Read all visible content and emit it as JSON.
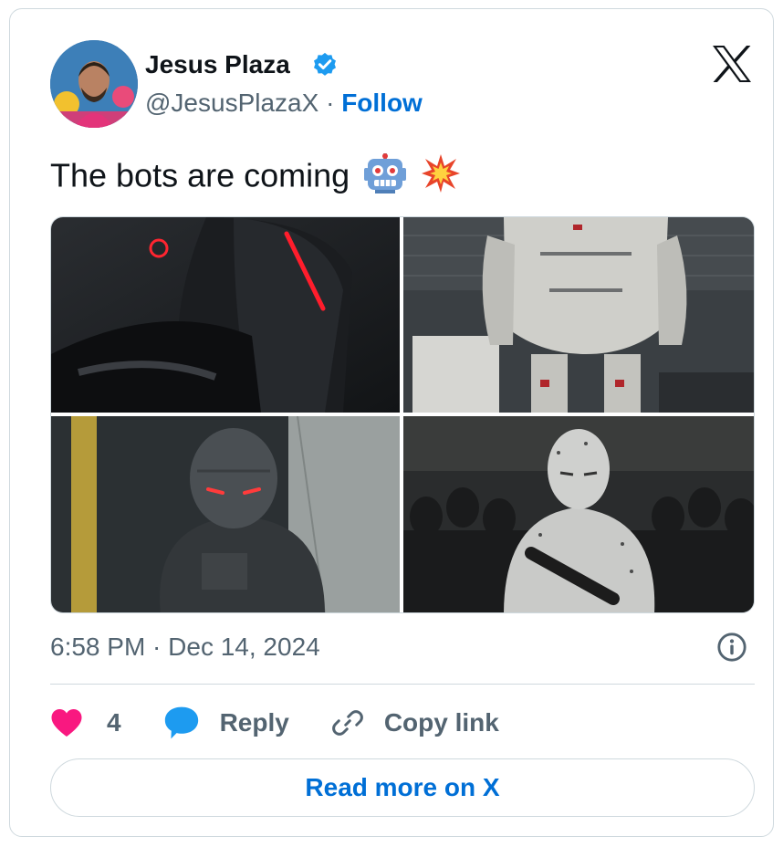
{
  "author": {
    "name": "Jesus Plaza",
    "handle": "@JesusPlazaX",
    "separator": " · ",
    "follow_label": "Follow",
    "verified": true,
    "avatar_icon": "profile-photo"
  },
  "brand": {
    "logo_icon": "x-logo-icon"
  },
  "tweet": {
    "text": "The bots are coming",
    "emojis": [
      "robot-face",
      "collision"
    ],
    "media_count": 4
  },
  "timestamp": "6:58 PM · Dec 14, 2024",
  "actions": {
    "like_count": "4",
    "reply_label": "Reply",
    "copy_label": "Copy link"
  },
  "read_more_label": "Read more on X",
  "colors": {
    "link": "#006fd6",
    "muted": "#536471",
    "border": "#cfd9de",
    "like": "#f91880",
    "reply": "#1d9bf0",
    "verified": "#1d9bf0"
  }
}
